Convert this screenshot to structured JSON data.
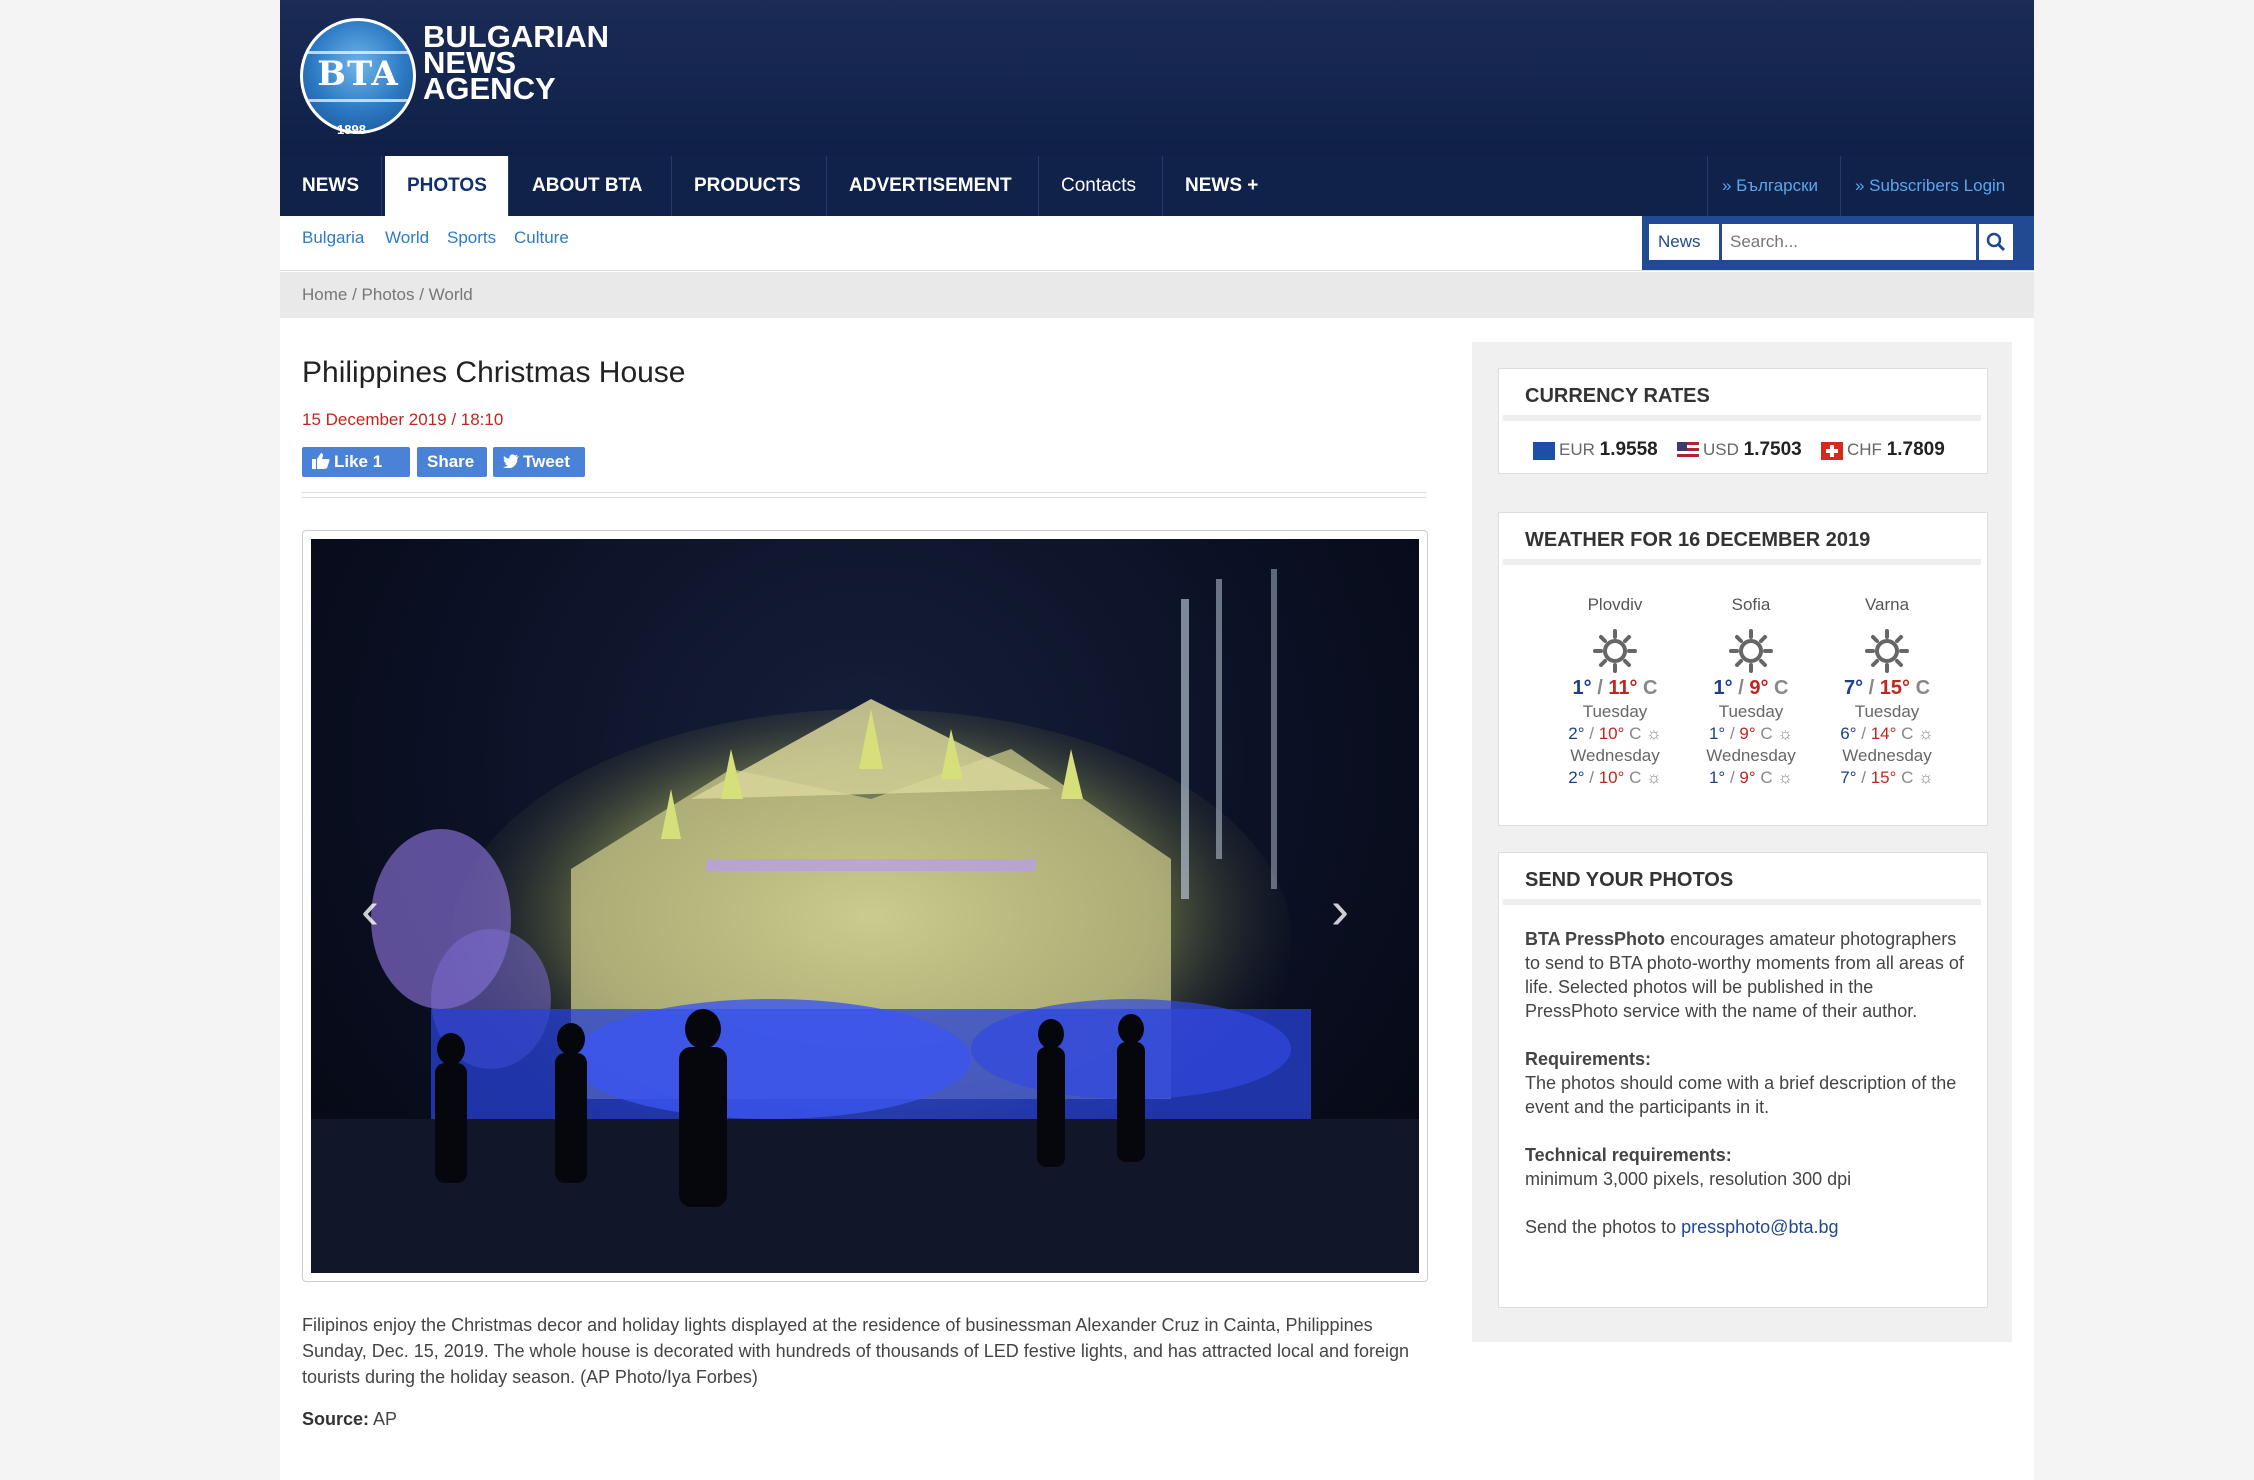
{
  "logo": {
    "abbr": "BTA",
    "line1": "BULGARIAN",
    "line2": "NEWS",
    "line3": "AGENCY",
    "year": "1898"
  },
  "nav": {
    "items": [
      {
        "label": "NEWS"
      },
      {
        "label": "PHOTOS"
      },
      {
        "label": "ABOUT BTA"
      },
      {
        "label": "PRODUCTS"
      },
      {
        "label": "ADVERTISEMENT"
      },
      {
        "label": "Contacts"
      },
      {
        "label": "NEWS +"
      }
    ],
    "lang_link": "» Български",
    "login_link": "» Subscribers Login"
  },
  "subnav": {
    "items": [
      "Bulgaria",
      "World",
      "Sports",
      "Culture"
    ]
  },
  "search": {
    "category": "News",
    "placeholder": "Search..."
  },
  "breadcrumb": {
    "home": "Home",
    "sep": " / ",
    "photos": "Photos",
    "world": "World"
  },
  "article": {
    "title": "Philippines Christmas House",
    "date": "15 December 2019 / 18:10",
    "like": "Like 1",
    "share": "Share",
    "tweet": "Tweet",
    "caption": "Filipinos enjoy the Christmas decor and holiday lights displayed at the residence of businessman Alexander Cruz in Cainta, Philippines Sunday, Dec. 15, 2019. The whole house is decorated with hundreds of thousands of LED festive lights, and has attracted local and foreign tourists during the holiday season. (AP Photo/Iya Forbes)",
    "source_label": "Source:",
    "source_value": " AP"
  },
  "currency": {
    "title": "CURRENCY RATES",
    "rates": [
      {
        "code": "EUR",
        "value": "1.9558"
      },
      {
        "code": "USD",
        "value": "1.7503"
      },
      {
        "code": "CHF",
        "value": "1.7809"
      }
    ]
  },
  "weather": {
    "title": "WEATHER FOR 16 DECEMBER 2019",
    "unit": "C",
    "cities": [
      {
        "name": "Plovdiv",
        "min": "1°",
        "max": "11°",
        "day2": "Tuesday",
        "d2min": "2°",
        "d2max": "10°",
        "day3": "Wednesday",
        "d3min": "2°",
        "d3max": "10°"
      },
      {
        "name": "Sofia",
        "min": "1°",
        "max": "9°",
        "day2": "Tuesday",
        "d2min": "1°",
        "d2max": "9°",
        "day3": "Wednesday",
        "d3min": "1°",
        "d3max": "9°"
      },
      {
        "name": "Varna",
        "min": "7°",
        "max": "15°",
        "day2": "Tuesday",
        "d2min": "6°",
        "d2max": "14°",
        "day3": "Wednesday",
        "d3min": "7°",
        "d3max": "15°"
      }
    ]
  },
  "send_photos": {
    "title": "SEND YOUR PHOTOS",
    "intro_bold": "BTA PressPhoto",
    "intro_text": " encourages amateur photographers to send to BTA photo-worthy moments from all areas of life. Selected photos will be published in the PressPhoto service with the name of their author.",
    "req_title": "Requirements:",
    "req_text": "The photos should come with a brief description of the event and the participants in it.",
    "tech_title": "Technical requirements:",
    "tech_text": "minimum 3,000 pixels, resolution 300 dpi",
    "send_text": "Send the photos to ",
    "email": "pressphoto@bta.bg"
  },
  "colors": {
    "header": "#10224a",
    "accent": "#2d7bc6",
    "date": "#c0261f",
    "temp_min": "#1c3f8e",
    "temp_max": "#c0261f"
  }
}
